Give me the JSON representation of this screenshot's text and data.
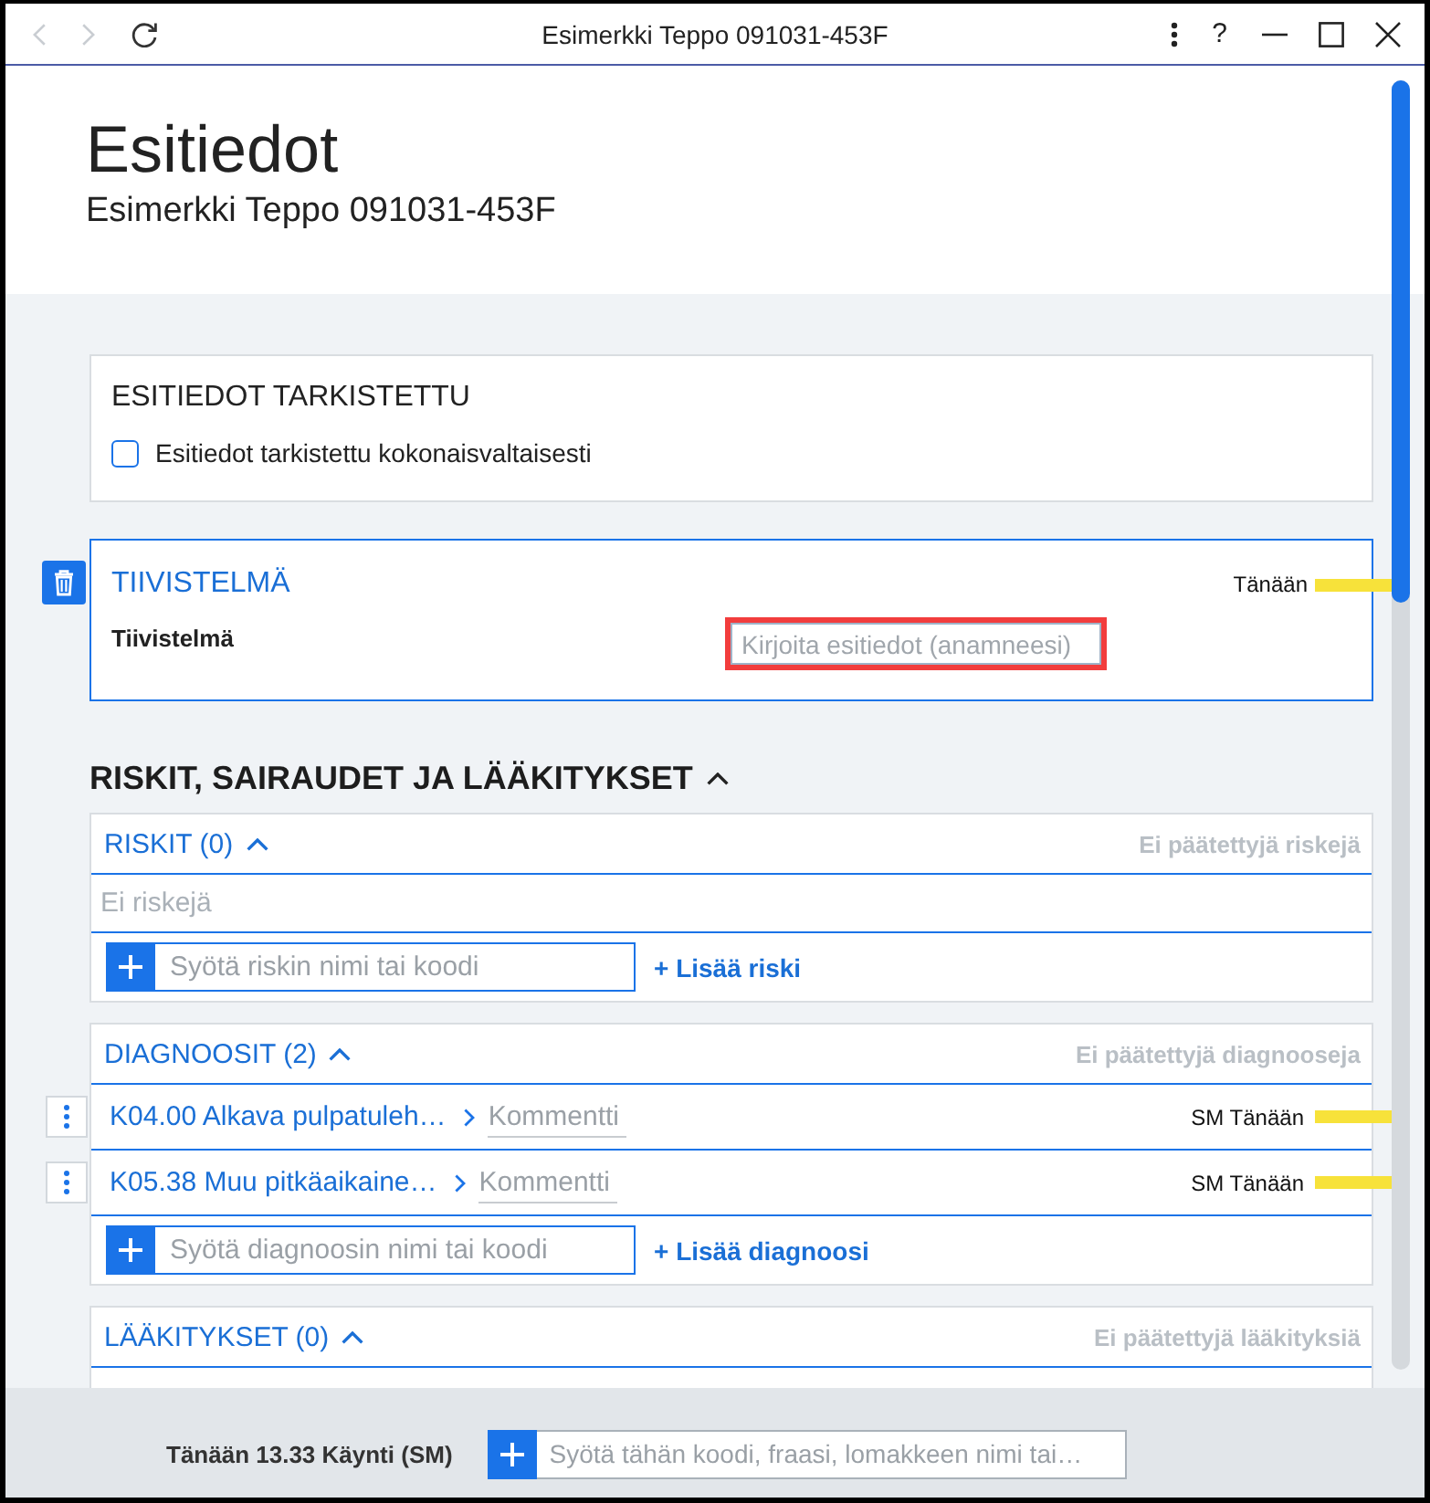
{
  "window": {
    "title": "Esimerkki Teppo 091031-453F",
    "nav_buttons": [
      {
        "kind": "back",
        "disabled": true
      },
      {
        "kind": "forward",
        "disabled": true
      },
      {
        "kind": "reload",
        "disabled": false
      }
    ],
    "controls": [
      {
        "kind": "menu"
      },
      {
        "kind": "help",
        "label": "?"
      },
      {
        "kind": "minimize"
      },
      {
        "kind": "maximize"
      },
      {
        "kind": "close"
      }
    ]
  },
  "header": {
    "title": "Esitiedot",
    "subtitle": "Esimerkki Teppo 091031-453F"
  },
  "review_card": {
    "title": "ESITIEDOT TARKISTETTU",
    "checkbox": {
      "label": "Esitiedot tarkistettu kokonaisvaltaisesti",
      "checked": false
    }
  },
  "summary_card": {
    "title": "TIIVISTELMÄ",
    "focused": true,
    "date": "Tänään",
    "field": {
      "label": "Tiivistelmä",
      "placeholder": "Kirjoita esitiedot (anamneesi)",
      "highlighted": true
    }
  },
  "section": {
    "title": "RISKIT, SAIRAUDET JA LÄÄKITYKSET",
    "expanded": true
  },
  "groups": [
    {
      "title": "RISKIT (0)",
      "expanded": true,
      "status": "Ei päätettyjä riskejä",
      "empty_text": "Ei riskejä",
      "add_placeholder": "Syötä riskin nimi tai koodi",
      "add_link": "+ Lisää riski"
    },
    {
      "title": "DIAGNOOSIT (2)",
      "expanded": true,
      "status": "Ei päätettyjä diagnooseja",
      "items": [
        {
          "name": "K04.00 Alkava pulpatuleh…",
          "comment_placeholder": "Kommentti",
          "meta": "SM Tänään"
        },
        {
          "name": "K05.38 Muu pitkäaikaine…",
          "comment_placeholder": "Kommentti",
          "meta": "SM Tänään"
        }
      ],
      "add_placeholder": "Syötä diagnoosin nimi tai koodi",
      "add_link": "+ Lisää diagnoosi"
    },
    {
      "title": "LÄÄKITYKSET (0)",
      "expanded": true,
      "status": "Ei päätettyjä lääkityksiä"
    }
  ],
  "footer": {
    "visit": "Tänään 13.33 Käynti (SM)",
    "command_placeholder": "Syötä tähän koodi, fraasi, lomakkeen nimi tai…"
  }
}
